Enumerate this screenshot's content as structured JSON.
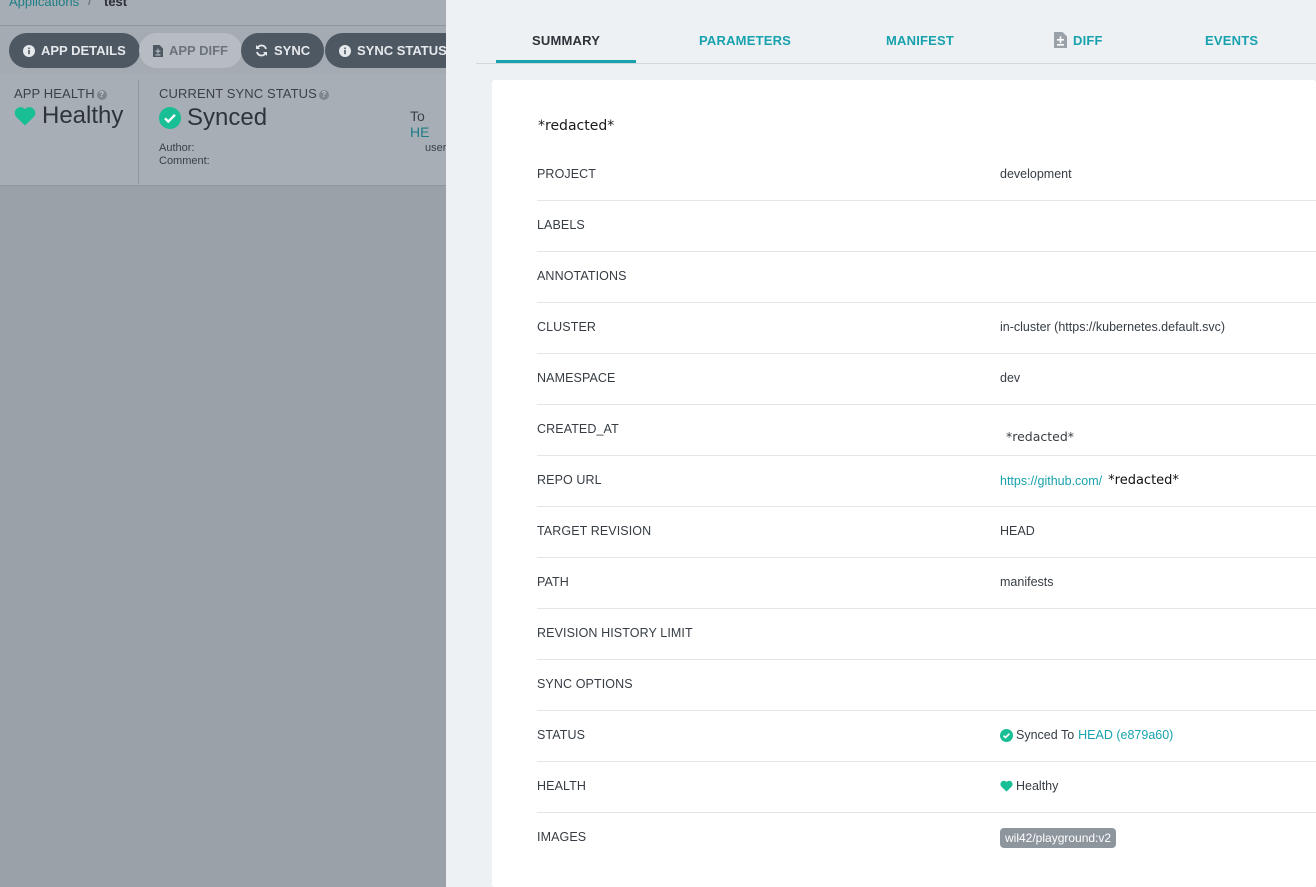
{
  "breadcrumb": {
    "root": "Applications",
    "sep": "/",
    "current": "test"
  },
  "actions": [
    {
      "label": "APP DETAILS",
      "icon": "info-icon"
    },
    {
      "label": "APP DIFF",
      "icon": "file-diff-icon"
    },
    {
      "label": "SYNC",
      "icon": "sync-icon"
    },
    {
      "label": "SYNC STATUS",
      "icon": "info-icon"
    }
  ],
  "status": {
    "health_label": "APP HEALTH",
    "health_value": "Healthy",
    "sync_label": "CURRENT SYNC STATUS",
    "sync_value": "Synced",
    "to_label": "To",
    "to_rev": "HE",
    "author_label": "Author:",
    "comment_label": "Comment:",
    "author_value": "user"
  },
  "tabs": [
    {
      "label": "SUMMARY",
      "active": true
    },
    {
      "label": "PARAMETERS"
    },
    {
      "label": "MANIFEST"
    },
    {
      "label": "DIFF"
    },
    {
      "label": "EVENTS"
    }
  ],
  "summary": {
    "app_name": "*redacted*",
    "rows": {
      "project": {
        "key": "PROJECT",
        "value": "development"
      },
      "labels": {
        "key": "LABELS"
      },
      "annotations": {
        "key": "ANNOTATIONS"
      },
      "cluster": {
        "key": "CLUSTER",
        "value": "in-cluster (https://kubernetes.default.svc)"
      },
      "namespace": {
        "key": "NAMESPACE",
        "value": "dev"
      },
      "created_at": {
        "key": "CREATED_AT",
        "value": "*redacted*"
      },
      "repo_url": {
        "key": "REPO URL",
        "value": "https://github.com/",
        "redacted": "*redacted*"
      },
      "target_revision": {
        "key": "TARGET REVISION",
        "value": "HEAD"
      },
      "path": {
        "key": "PATH",
        "value": "manifests"
      },
      "revision_history_limit": {
        "key": "REVISION HISTORY LIMIT"
      },
      "sync_options": {
        "key": "SYNC OPTIONS"
      },
      "status": {
        "key": "STATUS",
        "text": "Synced To",
        "link": "HEAD (e879a60)"
      },
      "health": {
        "key": "HEALTH",
        "value": "Healthy"
      },
      "images": {
        "key": "IMAGES",
        "value": "wil42/playground:v2"
      }
    }
  },
  "colors": {
    "accent": "#18a2ad",
    "healthy": "#18be94",
    "synced": "#18be94"
  }
}
